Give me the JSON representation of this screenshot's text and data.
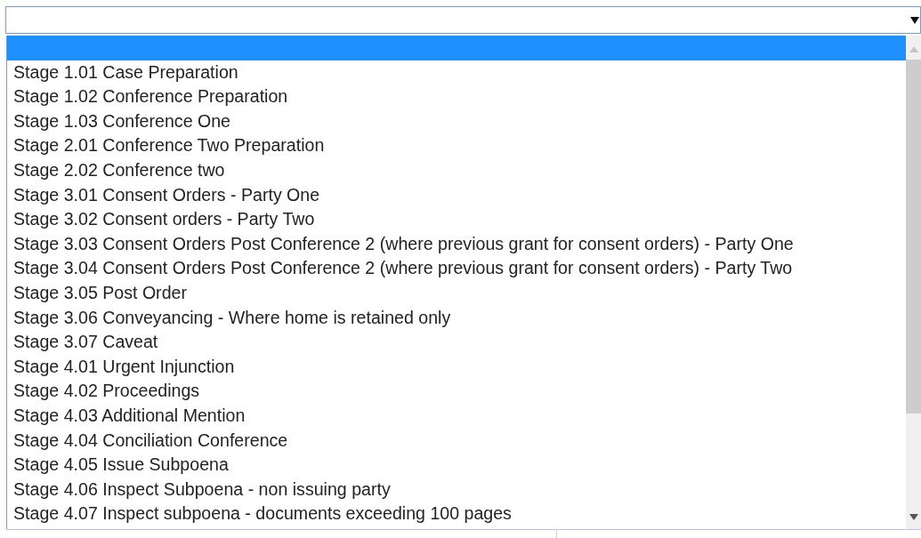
{
  "select": {
    "open": true
  },
  "list": {
    "blank_option": {
      "selected": true
    },
    "options": [
      {
        "label": "Stage 1.01 Case Preparation",
        "selected": false
      },
      {
        "label": "Stage 1.02 Conference Preparation",
        "selected": false
      },
      {
        "label": "Stage 1.03 Conference One",
        "selected": false
      },
      {
        "label": "Stage 2.01 Conference Two Preparation",
        "selected": false
      },
      {
        "label": "Stage 2.02 Conference two",
        "selected": false
      },
      {
        "label": "Stage 3.01 Consent Orders - Party One",
        "selected": false
      },
      {
        "label": "Stage 3.02 Consent orders - Party Two",
        "selected": false
      },
      {
        "label": "Stage 3.03 Consent Orders Post Conference 2 (where previous grant for consent orders) - Party One",
        "selected": false
      },
      {
        "label": "Stage 3.04 Consent Orders Post Conference 2 (where previous grant for consent orders) - Party Two",
        "selected": false
      },
      {
        "label": "Stage 3.05 Post Order",
        "selected": false
      },
      {
        "label": "Stage 3.06 Conveyancing - Where home is retained only",
        "selected": false
      },
      {
        "label": "Stage 3.07 Caveat",
        "selected": false
      },
      {
        "label": "Stage 4.01 Urgent Injunction",
        "selected": false
      },
      {
        "label": "Stage 4.02 Proceedings",
        "selected": false
      },
      {
        "label": "Stage 4.03 Additional Mention",
        "selected": false
      },
      {
        "label": "Stage 4.04 Conciliation Conference",
        "selected": false
      },
      {
        "label": "Stage 4.05 Issue Subpoena",
        "selected": false
      },
      {
        "label": "Stage 4.06 Inspect Subpoena - non issuing party",
        "selected": false
      },
      {
        "label": "Stage 4.07 Inspect subpoena - documents exceeding 100 pages",
        "selected": false
      }
    ]
  }
}
